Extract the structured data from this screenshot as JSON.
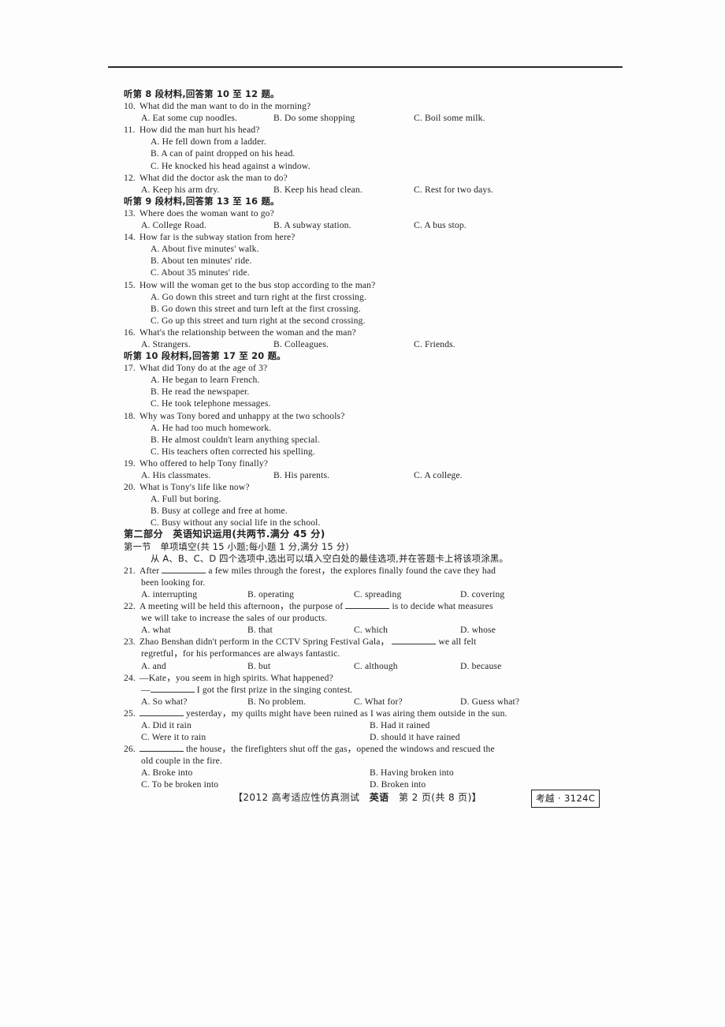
{
  "document": {
    "kind": "exam-paper-scan",
    "subject_label": "英语"
  },
  "listening": {
    "group8_heading": "听第 8 段材料,回答第 10 至 12 题。",
    "group9_heading": "听第 9 段材料,回答第 13 至 16 题。",
    "group10_heading": "听第 10 段材料,回答第 17 至 20 题。",
    "questions": [
      {
        "num": "10.",
        "stem": "What did the man want to do in the morning?",
        "layout": "row3",
        "options": [
          "A. Eat some cup noodles.",
          "B. Do some shopping",
          "C. Boil some milk."
        ]
      },
      {
        "num": "11.",
        "stem": "How did the man hurt his head?",
        "layout": "stack",
        "options": [
          "A. He fell down from a ladder.",
          "B. A can of paint dropped on his head.",
          "C. He knocked his head against a window."
        ]
      },
      {
        "num": "12.",
        "stem": "What did the doctor ask the man to do?",
        "layout": "row3",
        "options": [
          "A. Keep his arm dry.",
          "B. Keep his head clean.",
          "C. Rest for two days."
        ]
      },
      {
        "num": "13.",
        "stem": "Where does the woman want to go?",
        "layout": "row3",
        "options": [
          "A. College Road.",
          "B. A subway station.",
          "C. A bus stop."
        ]
      },
      {
        "num": "14.",
        "stem": "How far is the subway station from here?",
        "layout": "stack",
        "options": [
          "A. About five minutes' walk.",
          "B. About ten minutes' ride.",
          "C. About 35 minutes' ride."
        ]
      },
      {
        "num": "15.",
        "stem": "How will the woman get to the bus stop according to the man?",
        "layout": "stack",
        "options": [
          "A. Go down this street and turn right at the first crossing.",
          "B. Go down this street and turn left at the first crossing.",
          "C. Go up this street and turn right at the second crossing."
        ]
      },
      {
        "num": "16.",
        "stem": "What's the relationship between the woman and the man?",
        "layout": "row3",
        "options": [
          "A. Strangers.",
          "B. Colleagues.",
          "C. Friends."
        ]
      },
      {
        "num": "17.",
        "stem": "What did Tony do at the age of 3?",
        "layout": "stack",
        "options": [
          "A. He began to learn French.",
          "B. He read the newspaper.",
          "C. He took telephone messages."
        ]
      },
      {
        "num": "18.",
        "stem": "Why was Tony bored and unhappy at the two schools?",
        "layout": "stack",
        "options": [
          "A. He had too much homework.",
          "B. He almost couldn't learn anything special.",
          "C. His teachers often corrected his spelling."
        ]
      },
      {
        "num": "19.",
        "stem": "Who offered to help Tony finally?",
        "layout": "row3",
        "options": [
          "A. His classmates.",
          "B. His parents.",
          "C. A college."
        ]
      },
      {
        "num": "20.",
        "stem": "What is Tony's life like now?",
        "layout": "stack",
        "options": [
          "A. Full but boring.",
          "B. Busy at college and free at home.",
          "C. Busy without any social life in the school."
        ]
      }
    ]
  },
  "part2": {
    "heading": "第二部分　英语知识运用(共两节.满分 45 分)",
    "section1_heading": "第一节　单项填空(共 15 小题;每小题 1 分,满分 15 分)",
    "instruction": "从 A、B、C、D 四个选项中,选出可以填入空白处的最佳选项,并在答题卡上将该项涂黑。",
    "questions": [
      {
        "num": "21.",
        "stem_before": "After",
        "stem_after": "a few miles through the forest，the explores finally found the cave they had",
        "stem_line2": "been looking for.",
        "options": [
          "A. interrupting",
          "B. operating",
          "C. spreading",
          "D. covering"
        ],
        "opt_layout": "row4"
      },
      {
        "num": "22.",
        "stem_before": "A meeting will be held this afternoon，the purpose of",
        "stem_after": "is to decide what measures",
        "stem_line2": "we will take to increase the sales of our products.",
        "options": [
          "A. what",
          "B. that",
          "C. which",
          "D. whose"
        ],
        "opt_layout": "row4"
      },
      {
        "num": "23.",
        "stem_before": "Zhao Benshan didn't perform in the CCTV Spring Festival Gala，",
        "stem_after": "we all felt",
        "stem_line2": "regretful，for his performances are always fantastic.",
        "options": [
          "A. and",
          "B. but",
          "C. although",
          "D. because"
        ],
        "opt_layout": "row4"
      },
      {
        "num": "24.",
        "stem_before": "—Kate，you seem in high spirits. What happened?",
        "stem_after": "",
        "stem_line2": "—______ I got the first prize in the singing contest.",
        "options": [
          "A. So what?",
          "B. No problem.",
          "C. What for?",
          "D. Guess what?"
        ],
        "opt_layout": "row4"
      },
      {
        "num": "25.",
        "stem_before": "",
        "stem_after": "yesterday，my quilts might have been ruined as I was airing them outside in the sun.",
        "stem_line2": "",
        "options": [
          "A. Did it rain",
          "B. Had it rained",
          "C. Were it to rain",
          "D. should it have rained"
        ],
        "opt_layout": "grid2"
      },
      {
        "num": "26.",
        "stem_before": "",
        "stem_after": "the house，the firefighters shut off the gas，opened the windows and rescued the",
        "stem_line2": "old couple in the fire.",
        "options": [
          "A. Broke into",
          "B. Having broken into",
          "C. To be broken into",
          "D. Broken into"
        ],
        "opt_layout": "grid2"
      }
    ]
  },
  "footer": {
    "bracket_open": "【2012 高考适应性仿真测试　",
    "subject": "英语",
    "page_info": "　第 2 页(共 8 页)】",
    "code": "考越 · 3124C"
  }
}
